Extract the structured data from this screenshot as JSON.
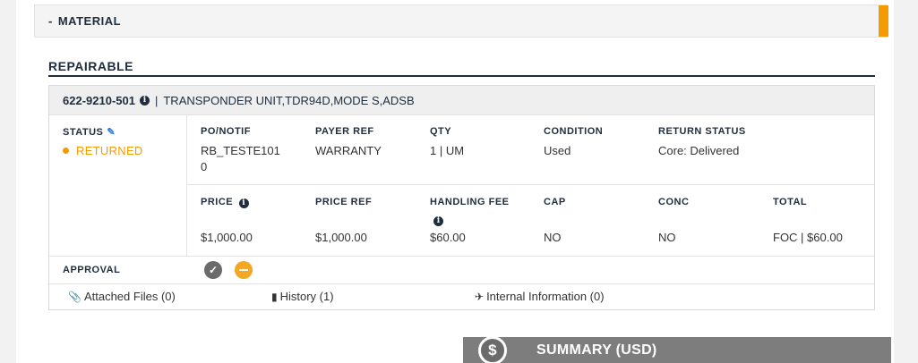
{
  "header": {
    "toggle": "-",
    "title": "MATERIAL"
  },
  "section": {
    "title": "REPAIRABLE"
  },
  "part": {
    "number": "622-9210-501",
    "separator": "|",
    "description": "TRANSPONDER UNIT,TDR94D,MODE S,ADSB"
  },
  "status": {
    "label": "STATUS",
    "value": "RETURNED"
  },
  "details": {
    "po_notif": {
      "label": "PO/NOTIF",
      "value_line1": "RB_TESTE101",
      "value_line2": "0"
    },
    "payer_ref": {
      "label": "PAYER REF",
      "value": "WARRANTY"
    },
    "qty": {
      "label": "QTY",
      "value": "1 | UM"
    },
    "condition": {
      "label": "CONDITION",
      "value": "Used"
    },
    "return_status": {
      "label": "RETURN STATUS",
      "value": "Core: Delivered"
    }
  },
  "pricing": {
    "price": {
      "label": "PRICE",
      "value": "$1,000.00"
    },
    "price_ref": {
      "label": "PRICE REF",
      "value": "$1,000.00"
    },
    "handling_fee": {
      "label": "HANDLING FEE",
      "value": "$60.00"
    },
    "cap": {
      "label": "CAP",
      "value": "NO"
    },
    "conc": {
      "label": "CONC",
      "value": "NO"
    },
    "total": {
      "label": "TOTAL",
      "value": "FOC | $60.00"
    }
  },
  "approval": {
    "label": "APPROVAL"
  },
  "links": {
    "attached_files": "Attached Files (0)",
    "history": "History (1)",
    "internal_info": "Internal Information (0)"
  },
  "summary": {
    "icon": "$",
    "title": "SUMMARY (USD)"
  },
  "colors": {
    "accent": "#f59b00",
    "navy": "#1f2d3d",
    "summary_bg": "#7d7d7d"
  },
  "icons": [
    "info-icon",
    "pencil-icon",
    "check-circle-icon",
    "minus-circle-icon",
    "paperclip-icon",
    "book-icon",
    "plane-icon",
    "dollar-icon"
  ]
}
